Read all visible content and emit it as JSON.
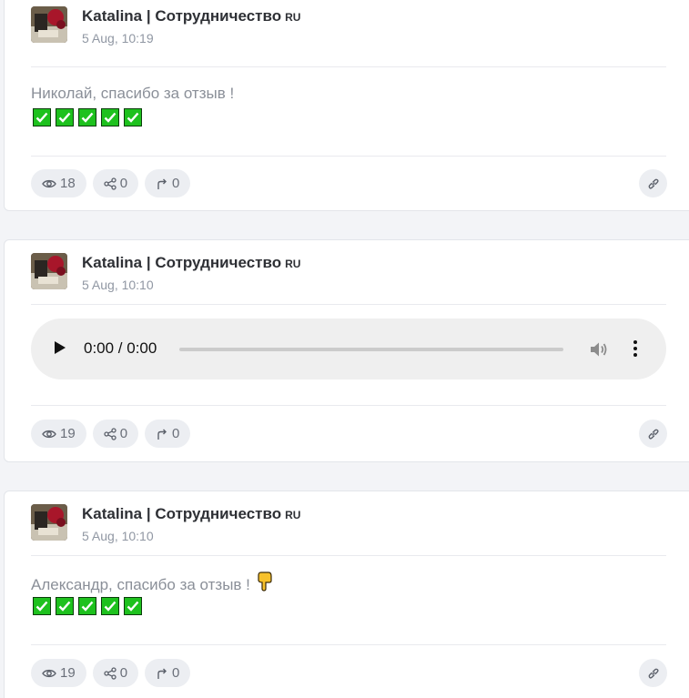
{
  "posts": [
    {
      "author": "Katalina | Сотрудничество",
      "flag": "RU",
      "date": "5 Aug, 10:19",
      "text": "Николай, спасибо за отзыв !",
      "checkmarks": 5,
      "views": "18",
      "shares": "0",
      "forwards": "0"
    },
    {
      "author": "Katalina | Сотрудничество",
      "flag": "RU",
      "date": "5 Aug, 10:10",
      "audio_time": "0:00 / 0:00",
      "audio_progress": 0,
      "views": "19",
      "shares": "0",
      "forwards": "0"
    },
    {
      "author": "Katalina | Сотрудничество",
      "flag": "RU",
      "date": "5 Aug, 10:10",
      "text": "Александр, спасибо за отзыв !",
      "emoji": "pointing-down-hand-icon",
      "checkmarks": 5,
      "views": "19",
      "shares": "0",
      "forwards": "0"
    }
  ],
  "icons": {
    "views": "eye-icon",
    "shares": "share-icon",
    "forwards": "forward-arrow-icon",
    "copy_link": "link-icon",
    "menu": "kebab-menu-icon",
    "checkmark": "green-check-box-icon"
  },
  "colors": {
    "check_green": "#1ec11e",
    "page_background": "#f3f4f7",
    "pill_background": "#eceef2"
  }
}
